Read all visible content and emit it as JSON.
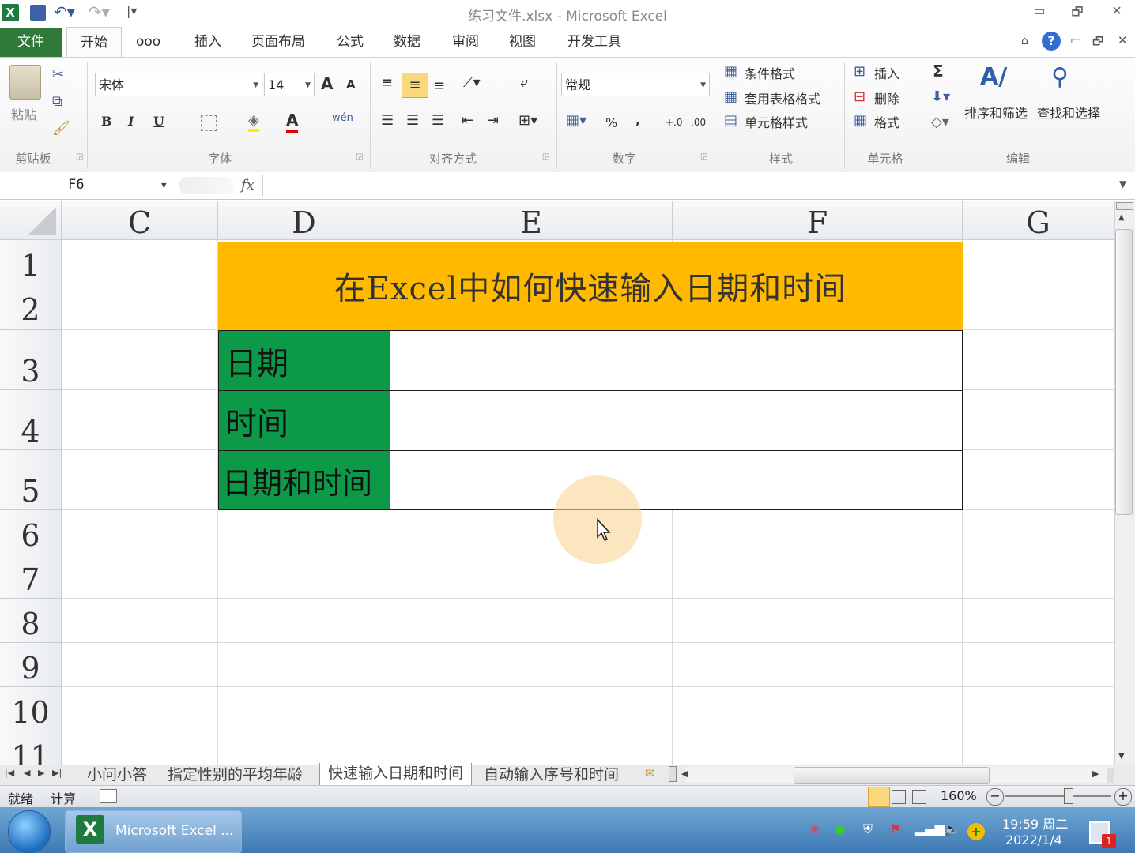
{
  "titlebar": {
    "title": "练习文件.xlsx  -  Microsoft Excel",
    "minimize": "▭",
    "restore": "🗗",
    "close": "✕"
  },
  "ribbon_tabs": {
    "file": "文件",
    "items": [
      "开始",
      "ooo",
      "插入",
      "页面布局",
      "公式",
      "数据",
      "审阅",
      "视图",
      "开发工具"
    ]
  },
  "clipboard": {
    "paste": "粘贴",
    "group": "剪贴板"
  },
  "font": {
    "name": "宋体",
    "size": "14",
    "bold": "B",
    "italic": "I",
    "underline": "U",
    "grow": "A",
    "shrink": "A",
    "font_color": "A",
    "phonetic": "wén",
    "group": "字体"
  },
  "alignment": {
    "group": "对齐方式"
  },
  "number": {
    "format": "常规",
    "percent": "%",
    "comma": ",",
    "inc_decimal": "+.0",
    "dec_decimal": ".00",
    "group": "数字"
  },
  "styles": {
    "conditional": "条件格式",
    "table": "套用表格格式",
    "cell": "单元格样式",
    "group": "样式"
  },
  "cells": {
    "insert": "插入",
    "delete": "删除",
    "format": "格式",
    "group": "单元格"
  },
  "editing": {
    "sigma": "Σ",
    "sort": "排序和筛选",
    "find": "查找和选择",
    "group": "编辑"
  },
  "formula_bar": {
    "name_box": "F6",
    "fx": "fx",
    "formula": ""
  },
  "columns": [
    "C",
    "D",
    "E",
    "F",
    "G"
  ],
  "rows": [
    "1",
    "2",
    "3",
    "4",
    "5",
    "6",
    "7",
    "8",
    "9",
    "10",
    "11"
  ],
  "sheet": {
    "title": "在Excel中如何快速输入日期和时间",
    "labels": [
      "日期",
      "时间",
      "日期和时间"
    ]
  },
  "sheet_tabs": [
    "小问小答",
    "指定性别的平均年龄",
    "快速输入日期和时间",
    "自动输入序号和时间"
  ],
  "active_sheet": "快速输入日期和时间",
  "statusbar": {
    "ready": "就绪",
    "calc": "计算",
    "zoom": "160%"
  },
  "taskbar": {
    "app": "Microsoft Excel ...",
    "time": "19:59 周二",
    "date": "2022/1/4",
    "badge": "1"
  },
  "colors": {
    "title_fill": "#ffba00",
    "label_fill": "#0c9a48",
    "file_tab": "#2f7a3a"
  }
}
